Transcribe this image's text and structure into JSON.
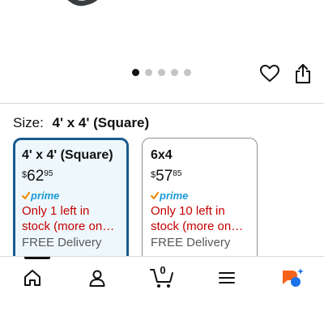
{
  "gallery": {
    "dot_count": 5,
    "active_index": 0
  },
  "size_selector": {
    "label": "Size:",
    "selected_value": "4' x 4' (Square)"
  },
  "options": [
    {
      "title": "4' x 4' (Square)",
      "price_currency": "$",
      "price_whole": "62",
      "price_fraction": "95",
      "prime_label": "prime",
      "stock_line1": "Only 1 left in",
      "stock_line2": "stock (more on…",
      "delivery": "FREE Delivery",
      "selected": true
    },
    {
      "title": "6x4",
      "price_currency": "$",
      "price_whole": "57",
      "price_fraction": "85",
      "prime_label": "prime",
      "stock_line1": "Only 10 left in",
      "stock_line2": "stock (more on…",
      "delivery": "FREE Delivery",
      "selected": false
    }
  ],
  "tabbar": {
    "cart_count": "0",
    "items": [
      "home-icon",
      "account-icon",
      "cart-icon",
      "menu-icon",
      "rufus-ai-icon"
    ]
  },
  "colors": {
    "selected_border": "#1a5b8e",
    "selected_bg": "#eef8fc",
    "prime_blue": "#1a98d5",
    "prime_check": "#f08804",
    "stock_red": "#c40000",
    "ai_orange": "#f7631b",
    "ai_blue": "#1a73e8"
  }
}
